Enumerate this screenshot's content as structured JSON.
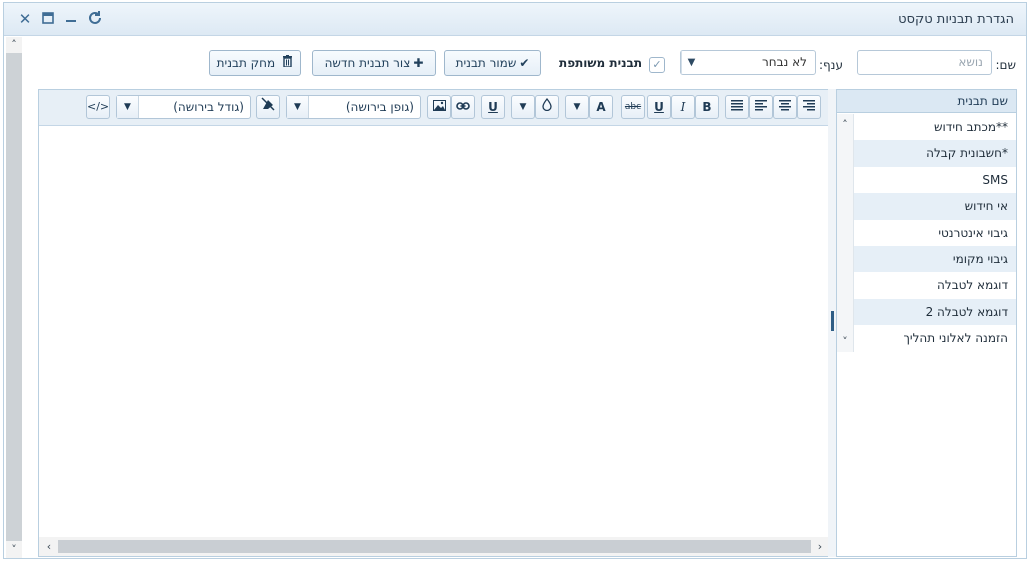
{
  "window": {
    "title": "הגדרת תבניות טקסט",
    "icons": [
      "refresh-icon",
      "minimize-icon",
      "maximize-icon",
      "close-icon"
    ]
  },
  "form": {
    "subject_label": "שם:",
    "subject_placeholder": "נושא",
    "branch_label": "ענף:",
    "branch_value": "לא נבחר",
    "shared_label": "תבנית משותפת",
    "shared_checked": true
  },
  "buttons": {
    "save": "שמור תבנית",
    "new": "צור תבנית חדשה",
    "delete": "מחק תבנית"
  },
  "toolbar": {
    "font_family": "(גופן בירושה)",
    "font_size": "(גודל בירושה)",
    "bold": "B",
    "italic": "I",
    "underline": "U",
    "strike": "abc",
    "font_color": "A",
    "underline2": "U"
  },
  "templates": {
    "header": "שם תבנית",
    "items": [
      "**מכתב חידוש",
      "*חשבונית קבלה",
      "SMS",
      "אי חידוש",
      "גיבוי אינטרנטי",
      "גיבוי מקומי",
      "דוגמא לטבלה",
      "דוגמא לטבלה 2",
      "הזמנה לאלוני תהליך"
    ]
  },
  "colors": {
    "accent": "#3f6d95",
    "header_bg": "#dbe8f3",
    "alt_row": "#e6eff7"
  }
}
